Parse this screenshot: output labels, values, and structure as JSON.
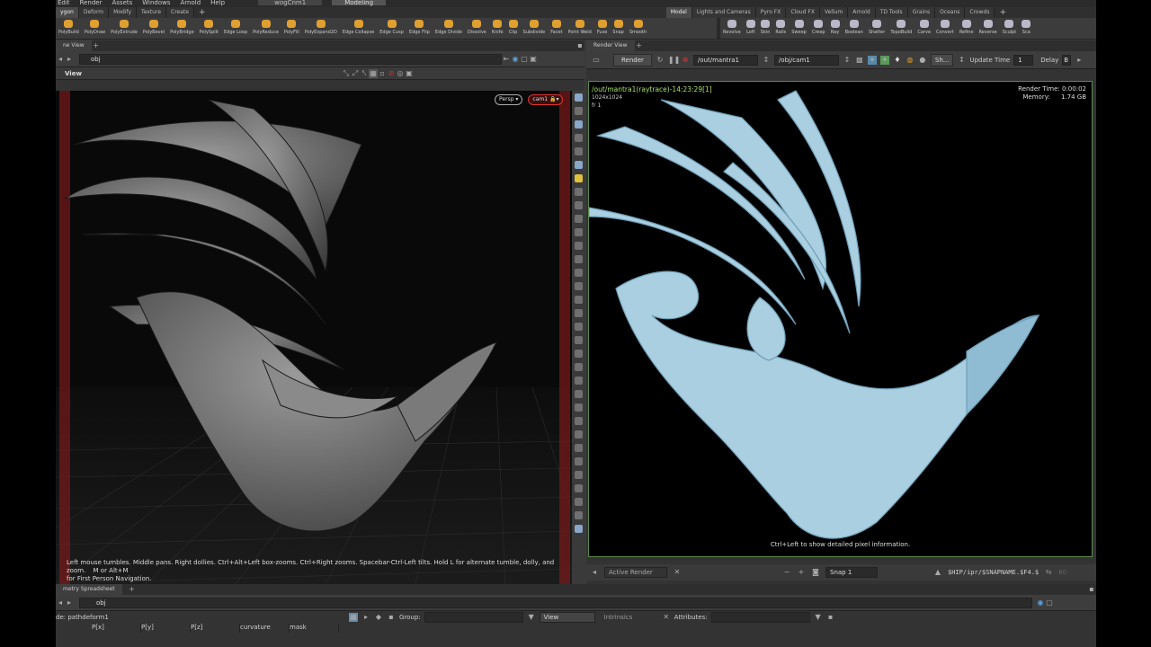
{
  "menu": {
    "items": [
      "Edit",
      "Render",
      "Assets",
      "Windows",
      "Arnold",
      "Help"
    ],
    "scene_tab": "wogCnm1",
    "desktop": "Modeling"
  },
  "shelf_tabs_left": [
    "ygon",
    "Deform",
    "Modify",
    "Texture",
    "Create"
  ],
  "shelf_tabs_right": [
    "Model",
    "Lights and Cameras",
    "Pyro FX",
    "Cloud FX",
    "Vellum",
    "Arnold",
    "TD Tools",
    "Grains",
    "Oceans",
    "Crowds"
  ],
  "tools_left": [
    "PolyBuild",
    "PolyDraw",
    "PolyExtrude",
    "PolyBevel",
    "PolyBridge",
    "PolySplit",
    "Edge Loop",
    "PolyReduce",
    "PolyFill",
    "PolyExpand2D",
    "Edge Collapse",
    "Edge Cusp",
    "Edge Flip",
    "Edge Divide",
    "Dissolve",
    "Knife",
    "Clip",
    "Subdivide",
    "Facet",
    "Point Weld",
    "Fuse",
    "Snap",
    "Smooth"
  ],
  "tools_right": [
    "Revolve",
    "Loft",
    "Skin",
    "Rails",
    "Sweep",
    "Creep",
    "Ray",
    "Boolean",
    "Shatter",
    "TopoBuild",
    "Carve",
    "Convert",
    "Refine",
    "Reverse",
    "Sculpt",
    "Sca"
  ],
  "colors": {
    "tool_icon": "#e0a030",
    "render_object": "#a9cfe0",
    "viewport_bg": "#0b0b0b"
  },
  "left_pane": {
    "tab": "ne View",
    "path": "obj",
    "viewer_label": "View",
    "persp": "Persp ▾",
    "cam": "cam1 🔒▾",
    "help_text": "Left mouse tumbles. Middle pans. Right dollies. Ctrl+Alt+Left box-zooms. Ctrl+Right zooms. Spacebar-Ctrl-Left tilts. Hold L for alternate tumble, dolly, and zoom.",
    "help_text2": "M or Alt+M",
    "help_text3": "for First Person Navigation."
  },
  "right_pane": {
    "tab": "Render View",
    "render_btn": "Render",
    "out_node": "/out/mantra1",
    "cam_node": "/obj/cam1",
    "sh_label": "Sh...",
    "update_time_label": "Update Time",
    "update_time_value": "1",
    "delay_label": "Delay",
    "delay_value": "B",
    "render_title": "/out/mantra1(raytrace)-14:23:29[1]",
    "resolution": "1024x1024",
    "frame": "fr 1",
    "render_time_label": "Render Time:",
    "render_time_value": "0:00:02",
    "memory_label": "Memory:",
    "memory_value": "1.74 GB",
    "hint": "Ctrl+Left to show detailed pixel information.",
    "active_render": "Active Render",
    "snap": "Snap  1",
    "snap_path": "$HIP/ipr/$SNAPNAME.$F4.$",
    "snap_num": "60"
  },
  "bottom_pane": {
    "tab": "metry Spreadsheet",
    "path": "obj",
    "node_label": "de: pathdeform1",
    "group_label": "Group:",
    "view_label": "View",
    "intrinsics_label": "Intrinsics",
    "attributes_label": "Attributes:",
    "columns": [
      "P[x]",
      "P[y]",
      "P[z]",
      "curvature",
      "mask"
    ]
  }
}
